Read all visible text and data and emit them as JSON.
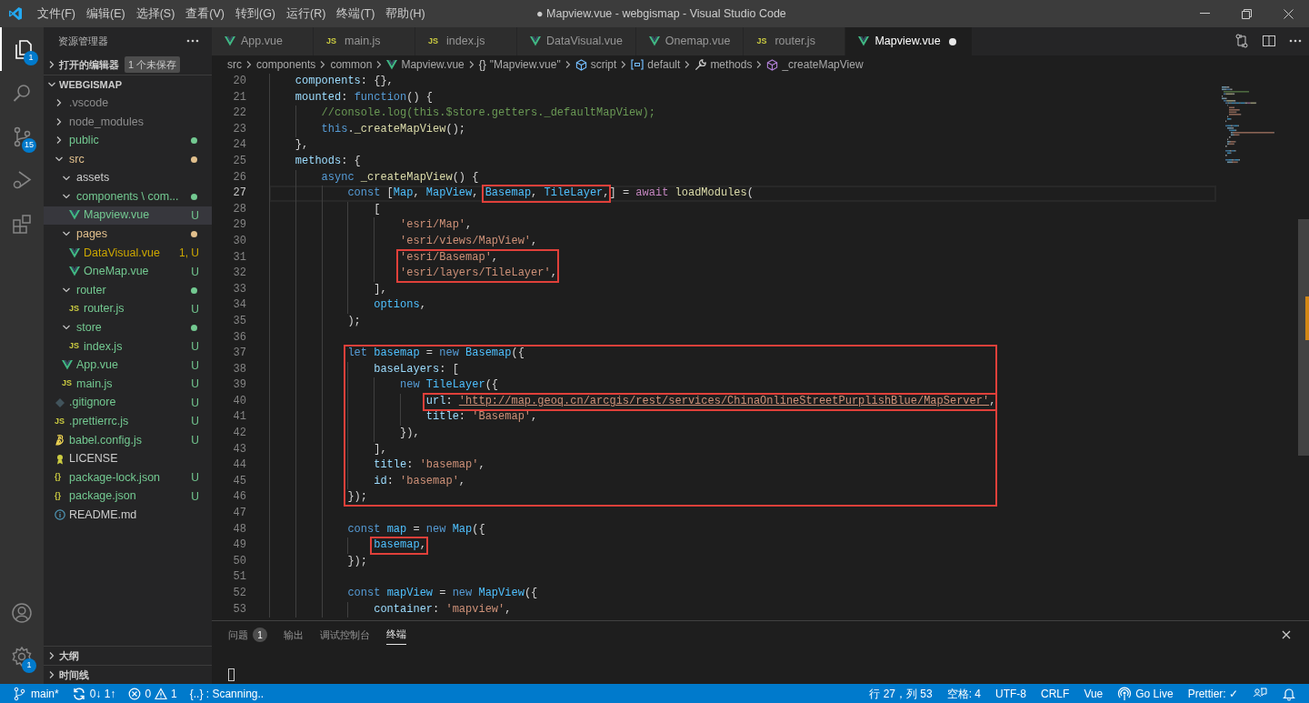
{
  "window": {
    "title": "● Mapview.vue - webgismap - Visual Studio Code"
  },
  "menu": [
    "文件(F)",
    "编辑(E)",
    "选择(S)",
    "查看(V)",
    "转到(G)",
    "运行(R)",
    "终端(T)",
    "帮助(H)"
  ],
  "activity_bar": [
    {
      "kind": "explorer",
      "selected": true,
      "badge": "1"
    },
    {
      "kind": "search",
      "selected": false
    },
    {
      "kind": "source-control",
      "selected": false,
      "badge": "15"
    },
    {
      "kind": "run",
      "selected": false
    },
    {
      "kind": "extensions",
      "selected": false
    }
  ],
  "activity_bar_bottom": [
    {
      "kind": "account"
    },
    {
      "kind": "settings",
      "badge": "1"
    }
  ],
  "explorer": {
    "title": "资源管理器",
    "open_editors": {
      "label": "打开的编辑器",
      "expanded": false,
      "badge": "1 个未保存"
    },
    "workspace": {
      "label": "WEBGISMAP",
      "expanded": true
    },
    "tree": [
      {
        "label": ".vscode",
        "kind": "folder",
        "expanded": false,
        "color": "#8c8c8c",
        "selected": false
      },
      {
        "label": "node_modules",
        "kind": "folder",
        "expanded": false,
        "color": "#8c8c8c",
        "selected": false
      },
      {
        "label": "public",
        "kind": "folder",
        "expanded": false,
        "color": "#73c991",
        "dot": true,
        "selected": false
      },
      {
        "label": "src",
        "kind": "folder",
        "expanded": true,
        "color": "#e2c08d",
        "dot": true,
        "selected": false,
        "children": [
          {
            "label": "assets",
            "kind": "folder",
            "expanded": true,
            "color": "#cccccc",
            "selected": false
          },
          {
            "label": "components \\ com...",
            "kind": "folder",
            "expanded": true,
            "color": "#73c991",
            "dot": true,
            "selected": false,
            "children": [
              {
                "label": "Mapview.vue",
                "kind": "vue",
                "color": "#73c991",
                "decoration": "U",
                "selected": true
              }
            ]
          },
          {
            "label": "pages",
            "kind": "folder",
            "expanded": true,
            "color": "#e2c08d",
            "dot": true,
            "selected": false,
            "children": [
              {
                "label": "DataVisual.vue",
                "kind": "vue",
                "color": "#cca700",
                "decoration": "1, U",
                "selected": false
              },
              {
                "label": "OneMap.vue",
                "kind": "vue",
                "color": "#73c991",
                "decoration": "U",
                "selected": false
              }
            ]
          },
          {
            "label": "router",
            "kind": "folder",
            "expanded": true,
            "color": "#73c991",
            "dot": true,
            "selected": false,
            "children": [
              {
                "label": "router.js",
                "kind": "js",
                "icon_text": "JS",
                "color": "#73c991",
                "decoration": "U",
                "selected": false
              }
            ]
          },
          {
            "label": "store",
            "kind": "folder",
            "expanded": true,
            "color": "#73c991",
            "dot": true,
            "selected": false,
            "children": [
              {
                "label": "index.js",
                "kind": "js",
                "icon_text": "JS",
                "color": "#73c991",
                "decoration": "U",
                "selected": false
              }
            ]
          },
          {
            "label": "App.vue",
            "kind": "vue",
            "color": "#73c991",
            "decoration": "U",
            "selected": false
          },
          {
            "label": "main.js",
            "kind": "js",
            "icon_text": "JS",
            "color": "#73c991",
            "decoration": "U",
            "selected": false
          }
        ]
      },
      {
        "label": ".gitignore",
        "kind": "git",
        "color": "#73c991",
        "decoration": "U",
        "selected": false
      },
      {
        "label": ".prettierrc.js",
        "kind": "js",
        "icon_text": "JS",
        "color": "#73c991",
        "decoration": "U",
        "selected": false
      },
      {
        "label": "babel.config.js",
        "kind": "babel",
        "color": "#73c991",
        "decoration": "U",
        "selected": false
      },
      {
        "label": "LICENSE",
        "kind": "license",
        "color": "#cccccc",
        "selected": false
      },
      {
        "label": "package-lock.json",
        "kind": "json",
        "icon_text": "{}",
        "color": "#73c991",
        "decoration": "U",
        "selected": false
      },
      {
        "label": "package.json",
        "kind": "json",
        "icon_text": "{}",
        "color": "#73c991",
        "decoration": "U",
        "selected": false
      },
      {
        "label": "README.md",
        "kind": "info",
        "color": "#cccccc",
        "selected": false
      }
    ],
    "bottom_sections": [
      {
        "label": "大纲",
        "expanded": false
      },
      {
        "label": "时间线",
        "expanded": false
      }
    ]
  },
  "tabs": [
    {
      "label": "App.vue",
      "kind": "vue",
      "selected": false,
      "modified": false
    },
    {
      "label": "main.js",
      "kind": "js",
      "icon_text": "JS",
      "selected": false,
      "modified": false
    },
    {
      "label": "index.js",
      "kind": "js",
      "icon_text": "JS",
      "selected": false,
      "modified": false
    },
    {
      "label": "DataVisual.vue",
      "kind": "vue",
      "selected": false,
      "modified": false
    },
    {
      "label": "Onemap.vue",
      "kind": "vue",
      "selected": false,
      "modified": false
    },
    {
      "label": "router.js",
      "kind": "js",
      "icon_text": "JS",
      "selected": false,
      "modified": false
    },
    {
      "label": "Mapview.vue",
      "kind": "vue",
      "selected": true,
      "modified": true
    }
  ],
  "breadcrumb": [
    {
      "label": "src",
      "kind": "folder"
    },
    {
      "label": "components",
      "kind": "folder"
    },
    {
      "label": "common",
      "kind": "folder"
    },
    {
      "label": "Mapview.vue",
      "kind": "vue"
    },
    {
      "label": "\"Mapview.vue\"",
      "kind": "module",
      "icon_text": "{}"
    },
    {
      "label": "script",
      "kind": "element"
    },
    {
      "label": "default",
      "kind": "variable"
    },
    {
      "label": "methods",
      "kind": "property"
    },
    {
      "label": "_createMapView",
      "kind": "method"
    }
  ],
  "code": [
    {
      "n": "20",
      "tokens": [
        {
          "t": "components",
          "kind": "prop"
        },
        {
          "t": ": {},",
          "kind": "punc"
        }
      ]
    },
    {
      "n": "21",
      "tokens": [
        {
          "t": "mounted",
          "kind": "prop"
        },
        {
          "t": ": ",
          "kind": "punc"
        },
        {
          "t": "function",
          "kind": "kw"
        },
        {
          "t": "() {",
          "kind": "punc"
        }
      ],
      "children": [
        {
          "n": "22",
          "tokens": [
            {
              "t": "//console.log(this.$store.getters._defaultMapView);",
              "kind": "cmt"
            }
          ]
        },
        {
          "n": "23",
          "tokens": [
            {
              "t": "this",
              "kind": "kw"
            },
            {
              "t": ".",
              "kind": "punc"
            },
            {
              "t": "_createMapView",
              "kind": "fn"
            },
            {
              "t": "();",
              "kind": "punc"
            }
          ]
        }
      ]
    },
    {
      "n": "24",
      "tokens": [
        {
          "t": "},",
          "kind": "punc"
        }
      ]
    },
    {
      "n": "25",
      "tokens": [
        {
          "t": "methods",
          "kind": "prop"
        },
        {
          "t": ": {",
          "kind": "punc"
        }
      ],
      "children": [
        {
          "n": "26",
          "tokens": [
            {
              "t": "async ",
              "kind": "kw"
            },
            {
              "t": "_createMapView",
              "kind": "fn"
            },
            {
              "t": "() {",
              "kind": "punc"
            }
          ],
          "children": [
            {
              "n": "27",
              "current": true,
              "tokens": [
                {
                  "t": "const",
                  "kind": "kw"
                },
                {
                  "t": " [",
                  "kind": "punc"
                },
                {
                  "t": "Map",
                  "kind": "var"
                },
                {
                  "t": ", ",
                  "kind": "punc"
                },
                {
                  "t": "MapView",
                  "kind": "var"
                },
                {
                  "t": ", ",
                  "kind": "punc"
                },
                {
                  "t": "Basemap",
                  "kind": "var",
                  "box_open": true
                },
                {
                  "t": ", ",
                  "kind": "punc"
                },
                {
                  "t": "TileLayer",
                  "kind": "var"
                },
                {
                  "t": ",",
                  "kind": "punc",
                  "box_close": true
                },
                {
                  "t": "] = ",
                  "kind": "punc"
                },
                {
                  "t": "await ",
                  "kind": "ctrl"
                },
                {
                  "t": "loadModules",
                  "kind": "fn"
                },
                {
                  "t": "(",
                  "kind": "punc"
                }
              ],
              "children": [
                {
                  "n": "28",
                  "tokens": [
                    {
                      "t": "[",
                      "kind": "punc"
                    }
                  ],
                  "children": [
                    {
                      "n": "29",
                      "tokens": [
                        {
                          "t": "'esri/Map'",
                          "kind": "str"
                        },
                        {
                          "t": ",",
                          "kind": "punc"
                        }
                      ]
                    },
                    {
                      "n": "30",
                      "tokens": [
                        {
                          "t": "'esri/views/MapView'",
                          "kind": "str"
                        },
                        {
                          "t": ",",
                          "kind": "punc"
                        }
                      ]
                    },
                    {
                      "n": "31",
                      "tokens": [
                        {
                          "t": "'esri/Basemap'",
                          "kind": "str",
                          "box_open": true
                        },
                        {
                          "t": ",",
                          "kind": "punc"
                        }
                      ]
                    },
                    {
                      "n": "32",
                      "tokens": [
                        {
                          "t": "'esri/layers/TileLayer'",
                          "kind": "str"
                        },
                        {
                          "t": ",",
                          "kind": "punc",
                          "box_close": true
                        }
                      ]
                    }
                  ]
                },
                {
                  "n": "33",
                  "tokens": [
                    {
                      "t": "],",
                      "kind": "punc"
                    }
                  ]
                },
                {
                  "n": "34",
                  "tokens": [
                    {
                      "t": "options",
                      "kind": "var"
                    },
                    {
                      "t": ",",
                      "kind": "punc"
                    }
                  ]
                }
              ]
            },
            {
              "n": "35",
              "tokens": [
                {
                  "t": ");",
                  "kind": "punc"
                }
              ]
            },
            {
              "n": "36"
            },
            {
              "n": "37",
              "tokens": [
                {
                  "t": "let ",
                  "kind": "kw",
                  "box_open": true
                },
                {
                  "t": "basemap",
                  "kind": "var"
                },
                {
                  "t": " = ",
                  "kind": "punc"
                },
                {
                  "t": "new ",
                  "kind": "kw"
                },
                {
                  "t": "Basemap",
                  "kind": "var"
                },
                {
                  "t": "({",
                  "kind": "punc"
                }
              ],
              "children": [
                {
                  "n": "38",
                  "tokens": [
                    {
                      "t": "baseLayers",
                      "kind": "prop"
                    },
                    {
                      "t": ": [",
                      "kind": "punc"
                    }
                  ],
                  "children": [
                    {
                      "n": "39",
                      "tokens": [
                        {
                          "t": "new ",
                          "kind": "kw"
                        },
                        {
                          "t": "TileLayer",
                          "kind": "var"
                        },
                        {
                          "t": "({",
                          "kind": "punc"
                        }
                      ],
                      "children": [
                        {
                          "n": "40",
                          "tokens": [
                            {
                              "t": "url",
                              "kind": "prop",
                              "box_open": true
                            },
                            {
                              "t": ": ",
                              "kind": "punc"
                            },
                            {
                              "t": "'http://map.geoq.cn/arcgis/rest/services/ChinaOnlineStreetPurplishBlue/MapServer'",
                              "kind": "link"
                            },
                            {
                              "t": ",",
                              "kind": "punc",
                              "box_close": true
                            }
                          ]
                        },
                        {
                          "n": "41",
                          "tokens": [
                            {
                              "t": "title",
                              "kind": "prop"
                            },
                            {
                              "t": ": ",
                              "kind": "punc"
                            },
                            {
                              "t": "'Basemap'",
                              "kind": "str"
                            },
                            {
                              "t": ",",
                              "kind": "punc"
                            }
                          ]
                        }
                      ]
                    },
                    {
                      "n": "42",
                      "tokens": [
                        {
                          "t": "}),",
                          "kind": "punc"
                        }
                      ]
                    }
                  ]
                },
                {
                  "n": "43",
                  "tokens": [
                    {
                      "t": "],",
                      "kind": "punc"
                    }
                  ]
                },
                {
                  "n": "44",
                  "tokens": [
                    {
                      "t": "title",
                      "kind": "prop"
                    },
                    {
                      "t": ": ",
                      "kind": "punc"
                    },
                    {
                      "t": "'basemap'",
                      "kind": "str"
                    },
                    {
                      "t": ",",
                      "kind": "punc"
                    }
                  ]
                },
                {
                  "n": "45",
                  "tokens": [
                    {
                      "t": "id",
                      "kind": "prop"
                    },
                    {
                      "t": ": ",
                      "kind": "punc"
                    },
                    {
                      "t": "'basemap'",
                      "kind": "str"
                    },
                    {
                      "t": ",",
                      "kind": "punc"
                    }
                  ]
                }
              ]
            },
            {
              "n": "46",
              "tokens": [
                {
                  "t": "});",
                  "kind": "punc",
                  "box_close": true
                }
              ]
            },
            {
              "n": "47"
            },
            {
              "n": "48",
              "tokens": [
                {
                  "t": "const ",
                  "kind": "kw"
                },
                {
                  "t": "map",
                  "kind": "var"
                },
                {
                  "t": " = ",
                  "kind": "punc"
                },
                {
                  "t": "new ",
                  "kind": "kw"
                },
                {
                  "t": "Map",
                  "kind": "var"
                },
                {
                  "t": "({",
                  "kind": "punc"
                }
              ],
              "children": [
                {
                  "n": "49",
                  "tokens": [
                    {
                      "t": "basemap",
                      "kind": "var",
                      "box_open": true
                    },
                    {
                      "t": ",",
                      "kind": "punc",
                      "box_close": true
                    }
                  ]
                }
              ]
            },
            {
              "n": "50",
              "tokens": [
                {
                  "t": "});",
                  "kind": "punc"
                }
              ]
            },
            {
              "n": "51"
            },
            {
              "n": "52",
              "tokens": [
                {
                  "t": "const ",
                  "kind": "kw"
                },
                {
                  "t": "mapView",
                  "kind": "var"
                },
                {
                  "t": " = ",
                  "kind": "punc"
                },
                {
                  "t": "new ",
                  "kind": "kw"
                },
                {
                  "t": "MapView",
                  "kind": "var"
                },
                {
                  "t": "({",
                  "kind": "punc"
                }
              ],
              "children": [
                {
                  "n": "53",
                  "tokens": [
                    {
                      "t": "container",
                      "kind": "prop"
                    },
                    {
                      "t": ": ",
                      "kind": "punc"
                    },
                    {
                      "t": "'mapview'",
                      "kind": "str"
                    },
                    {
                      "t": ",",
                      "kind": "punc"
                    }
                  ]
                }
              ]
            }
          ]
        }
      ]
    }
  ],
  "panel": {
    "tabs": [
      {
        "label": "问题",
        "badge": "1",
        "selected": false
      },
      {
        "label": "输出",
        "selected": false
      },
      {
        "label": "调试控制台",
        "selected": false
      },
      {
        "label": "终端",
        "selected": true
      }
    ]
  },
  "status_bar": {
    "left": [
      {
        "kind": "branch",
        "label": "main*"
      },
      {
        "kind": "sync",
        "label": "0↓ 1↑"
      },
      {
        "kind": "problems",
        "errors": "0",
        "warnings": "1"
      },
      {
        "kind": "text",
        "label": "{..} : Scanning.."
      }
    ],
    "right": [
      {
        "kind": "text",
        "label": "行 27，列 53"
      },
      {
        "kind": "text",
        "label": "空格: 4"
      },
      {
        "kind": "text",
        "label": "UTF-8"
      },
      {
        "kind": "text",
        "label": "CRLF"
      },
      {
        "kind": "text",
        "label": "Vue"
      },
      {
        "kind": "golive",
        "label": "Go Live"
      },
      {
        "kind": "text",
        "label": "Prettier: ✓"
      },
      {
        "kind": "feedback"
      },
      {
        "kind": "bell"
      }
    ]
  }
}
